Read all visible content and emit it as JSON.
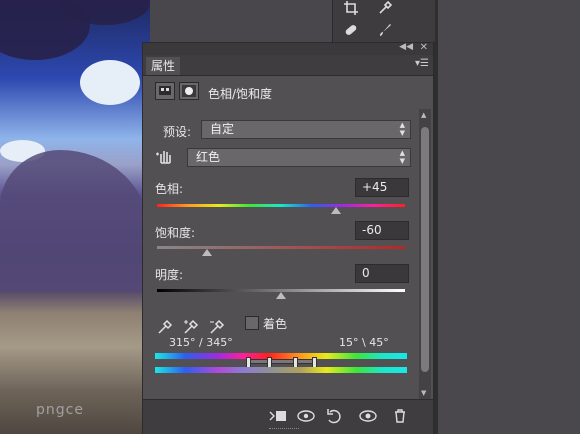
{
  "panel": {
    "tab_label": "属性",
    "title": "色相/饱和度",
    "preset_label": "预设:",
    "preset_value": "自定",
    "channel_value": "红色",
    "hue_label": "色相:",
    "hue_value": "+45",
    "saturation_label": "饱和度:",
    "saturation_value": "-60",
    "lightness_label": "明度:",
    "lightness_value": "0",
    "colorize_label": "着色",
    "range_left": "315° / 345°",
    "range_right": "15° \\ 45°"
  },
  "sliders": {
    "hue": 0.72,
    "saturation": 0.2,
    "lightness": 0.5
  },
  "icons": {
    "adjustment_layer": "adjustment-layer-icon",
    "mask": "mask-icon",
    "target_adjust": "hand-adjust-icon",
    "eyedropper": "eyedropper-icon",
    "eyedropper_plus": "eyedropper-plus-icon",
    "eyedropper_minus": "eyedropper-minus-icon",
    "clip_to_layer": "clip-to-layer-icon",
    "view_previous": "view-previous-icon",
    "reset": "reset-icon",
    "visibility": "eye-icon",
    "delete": "trash-icon"
  },
  "photo_watermark": "pngce"
}
